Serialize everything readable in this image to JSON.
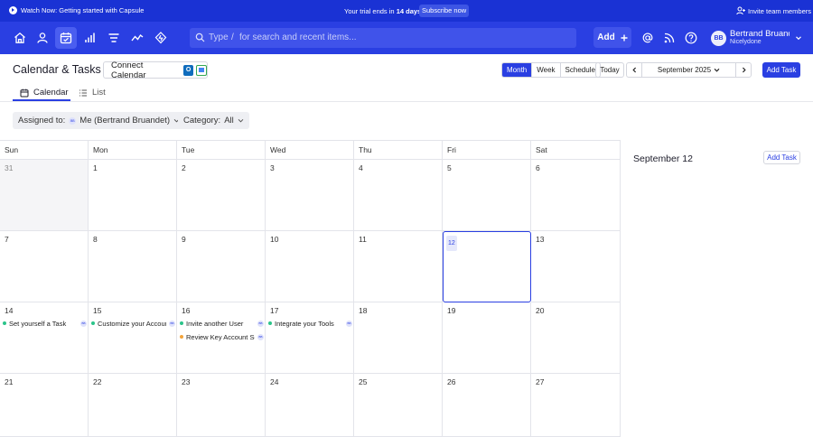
{
  "announcement": {
    "watch_label": "Watch Now: Getting started with Capsule",
    "trial_prefix": "Your trial ends in",
    "trial_days": "14 days",
    "subscribe_label": "Subscribe now",
    "invite_label": "Invite team members"
  },
  "nav": {
    "icons": [
      "home-icon",
      "person-icon",
      "calendar-check-icon",
      "bar-chart-icon",
      "list-icon",
      "trend-line-icon",
      "lightning-icon"
    ],
    "active_index": 2,
    "search_type": "Type",
    "search_slash": "/",
    "search_hint": "for search and recent items...",
    "add_label": "Add",
    "user_initials": "BB",
    "user_name": "Bertrand Bruandet",
    "user_org": "Nicelydone"
  },
  "header": {
    "title": "Calendar & Tasks",
    "connect_label": "Connect Calendar",
    "views": [
      "Month",
      "Week",
      "Schedule"
    ],
    "active_view": "Month",
    "today_label": "Today",
    "month_label": "September 2025",
    "add_task_label": "Add Task"
  },
  "tabs": [
    {
      "label": "Calendar",
      "active": true
    },
    {
      "label": "List",
      "active": false
    }
  ],
  "filters": {
    "assigned_label": "Assigned to:",
    "assigned_value": "Me (Bertrand Bruandet)",
    "category_label": "Category:",
    "category_value": "All"
  },
  "calendar": {
    "weekdays": [
      "Sun",
      "Mon",
      "Tue",
      "Wed",
      "Thu",
      "Fri",
      "Sat"
    ],
    "weeks": [
      [
        {
          "d": "31",
          "other": true
        },
        {
          "d": "1"
        },
        {
          "d": "2"
        },
        {
          "d": "3"
        },
        {
          "d": "4"
        },
        {
          "d": "5"
        },
        {
          "d": "6"
        }
      ],
      [
        {
          "d": "7"
        },
        {
          "d": "8"
        },
        {
          "d": "9"
        },
        {
          "d": "10"
        },
        {
          "d": "11"
        },
        {
          "d": "12",
          "today": true
        },
        {
          "d": "13"
        }
      ],
      [
        {
          "d": "14",
          "tasks": [
            {
              "name": "Set yourself a Task",
              "color": "green"
            }
          ]
        },
        {
          "d": "15",
          "tasks": [
            {
              "name": "Customize your Account",
              "color": "green"
            }
          ]
        },
        {
          "d": "16",
          "tasks": [
            {
              "name": "Invite another User",
              "color": "green"
            },
            {
              "name": "Review Key Account Settings",
              "color": "orange"
            }
          ]
        },
        {
          "d": "17",
          "tasks": [
            {
              "name": "Integrate your Tools",
              "color": "green"
            }
          ]
        },
        {
          "d": "18"
        },
        {
          "d": "19"
        },
        {
          "d": "20"
        }
      ],
      [
        {
          "d": "21"
        },
        {
          "d": "22"
        },
        {
          "d": "23"
        },
        {
          "d": "24"
        },
        {
          "d": "25"
        },
        {
          "d": "26"
        },
        {
          "d": "27"
        }
      ]
    ]
  },
  "side_panel": {
    "date_label": "September 12",
    "add_task_label": "Add Task"
  },
  "colors": {
    "brand": "#2a3fe2",
    "announcement": "#1a32d4",
    "task_green": "#2bc48a",
    "task_orange": "#f2a33a"
  }
}
